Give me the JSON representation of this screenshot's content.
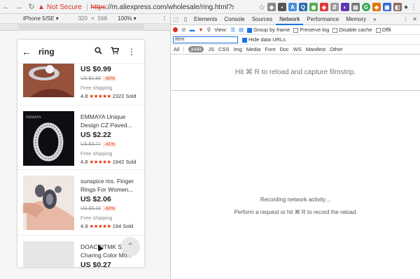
{
  "browser": {
    "security_label": "Not Secure",
    "url_scheme": "https",
    "url_rest": "://m.aliexpress.com/wholesale/ring.html?se..."
  },
  "device": {
    "name": "iPhone 5/SE ▾",
    "width": "320",
    "times": "×",
    "height": "568",
    "zoom": "100% ▾"
  },
  "app": {
    "query": "ring"
  },
  "products": [
    {
      "title": "",
      "price": "US $0.99",
      "old_price": "US $1.98",
      "discount": "-50%",
      "shipping": "Free shipping",
      "rating": "4.8",
      "sold": "2322 Sold"
    },
    {
      "title": "EMMAYA Unique Design CZ Paved...",
      "price": "US $2.22",
      "old_price": "US $3.77",
      "discount": "-41%",
      "shipping": "Free shipping",
      "rating": "4.8",
      "sold": "1942 Sold"
    },
    {
      "title": "sunspice ms. Finger Rings For Women...",
      "price": "US $2.06",
      "old_price": "US $5.16",
      "discount": "-60%",
      "shipping": "Free shipping",
      "rating": "4.9",
      "sold": "194 Sold"
    },
    {
      "title": "DOACCITMK St... Charing Color Mo...",
      "price": "US $0.27"
    }
  ],
  "devtools": {
    "tabs": [
      "Elements",
      "Console",
      "Sources",
      "Network",
      "Performance",
      "Memory"
    ],
    "more": "»",
    "active_tab": "Network",
    "toolbar": {
      "view_label": "View:",
      "group_by_frame": "Group by frame",
      "preserve_log": "Preserve log",
      "disable_cache": "Disable cache",
      "offline": "Offli"
    },
    "filter_value": "item",
    "hide_data_urls": "Hide data URLs",
    "types": [
      "All",
      "XHR",
      "JS",
      "CSS",
      "Img",
      "Media",
      "Font",
      "Doc",
      "WS",
      "Manifest",
      "Other"
    ],
    "active_type": "XHR",
    "filmstrip_message": "Hit ⌘ R to reload and capture filmstrip.",
    "recording_message": "Recording network activity…",
    "perform_message": "Perform a request or hit ⌘ R to record the reload."
  },
  "colors": {
    "accent": "#1a73e8",
    "record": "#d93025",
    "ali_red": "#e62e04"
  }
}
